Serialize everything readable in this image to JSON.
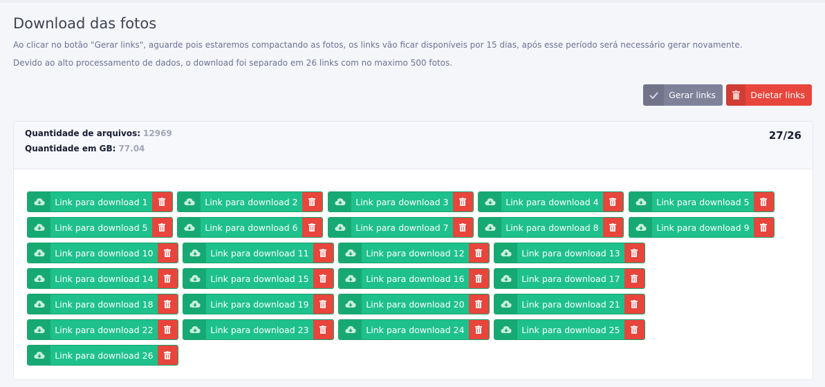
{
  "page": {
    "title": "Download das fotos",
    "description_1": "Ao clicar no botão \"Gerar links\", aguarde pois estaremos compactando as fotos, os links vão ficar disponíveis por 15 dias, após esse período será necessário gerar novamente.",
    "description_2": "Devido ao alto processamento de dados, o download foi separado em 26 links com no maximo 500 fotos."
  },
  "actions": {
    "generate_label": "Gerar links",
    "delete_label": "Deletar links"
  },
  "summary": {
    "files_label": "Quantidade de arquivos:",
    "files_value": "12969",
    "size_label": "Quantidade em GB:",
    "size_value": "77.04",
    "counter": "27/26"
  },
  "links": [
    "Link para download 1",
    "Link para download 2",
    "Link para download 3",
    "Link para download 4",
    "Link para download 5",
    "Link para download 5",
    "Link para download 6",
    "Link para download 7",
    "Link para download 8",
    "Link para download 9",
    "Link para download 10",
    "Link para download 11",
    "Link para download 12",
    "Link para download 13",
    "Link para download 14",
    "Link para download 15",
    "Link para download 16",
    "Link para download 17",
    "Link para download 18",
    "Link para download 19",
    "Link para download 20",
    "Link para download 21",
    "Link para download 22",
    "Link para download 23",
    "Link para download 24",
    "Link para download 25",
    "Link para download 26"
  ],
  "icons": {
    "generate": "check-icon",
    "delete": "trash-icon",
    "download": "cloud-download-icon"
  },
  "colors": {
    "green": "#1ec18c",
    "green_dark": "#17a974",
    "red": "#e8453c",
    "gray": "#7e8299"
  }
}
